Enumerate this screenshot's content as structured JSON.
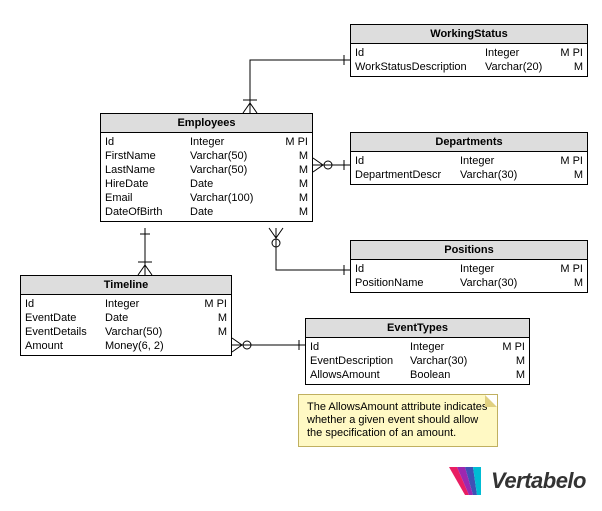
{
  "entities": {
    "workingStatus": {
      "title": "WorkingStatus",
      "rows": [
        {
          "name": "Id",
          "type": "Integer",
          "flags": "M PI"
        },
        {
          "name": "WorkStatusDescription",
          "type": "Varchar(20)",
          "flags": "M"
        }
      ]
    },
    "employees": {
      "title": "Employees",
      "rows": [
        {
          "name": "Id",
          "type": "Integer",
          "flags": "M PI"
        },
        {
          "name": "FirstName",
          "type": "Varchar(50)",
          "flags": "M"
        },
        {
          "name": "LastName",
          "type": "Varchar(50)",
          "flags": "M"
        },
        {
          "name": "HireDate",
          "type": "Date",
          "flags": "M"
        },
        {
          "name": "Email",
          "type": "Varchar(100)",
          "flags": "M"
        },
        {
          "name": "DateOfBirth",
          "type": "Date",
          "flags": "M"
        }
      ]
    },
    "departments": {
      "title": "Departments",
      "rows": [
        {
          "name": "Id",
          "type": "Integer",
          "flags": "M PI"
        },
        {
          "name": "DepartmentDescr",
          "type": "Varchar(30)",
          "flags": "M"
        }
      ]
    },
    "positions": {
      "title": "Positions",
      "rows": [
        {
          "name": "Id",
          "type": "Integer",
          "flags": "M PI"
        },
        {
          "name": "PositionName",
          "type": "Varchar(30)",
          "flags": "M"
        }
      ]
    },
    "timeline": {
      "title": "Timeline",
      "rows": [
        {
          "name": "Id",
          "type": "Integer",
          "flags": "M PI"
        },
        {
          "name": "EventDate",
          "type": "Date",
          "flags": "M"
        },
        {
          "name": "EventDetails",
          "type": "Varchar(50)",
          "flags": "M"
        },
        {
          "name": "Amount",
          "type": "Money(6, 2)",
          "flags": ""
        }
      ]
    },
    "eventTypes": {
      "title": "EventTypes",
      "rows": [
        {
          "name": "Id",
          "type": "Integer",
          "flags": "M PI"
        },
        {
          "name": "EventDescription",
          "type": "Varchar(30)",
          "flags": "M"
        },
        {
          "name": "AllowsAmount",
          "type": "Boolean",
          "flags": "M"
        }
      ]
    }
  },
  "note": {
    "text": "The AllowsAmount attribute indicates whether a given event should allow the specification of an amount."
  },
  "logo": {
    "text": "Vertabelo"
  }
}
